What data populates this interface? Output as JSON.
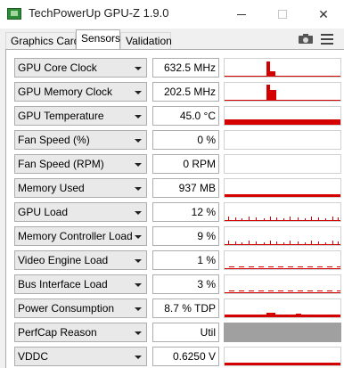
{
  "window": {
    "title": "TechPowerUp GPU-Z 1.9.0",
    "minimize_glyph": "—",
    "maximize_glyph": "☐",
    "close_glyph": "✕"
  },
  "tabs": [
    {
      "label": "Graphics Card",
      "active": false
    },
    {
      "label": "Sensors",
      "active": true
    },
    {
      "label": "Validation",
      "active": false
    }
  ],
  "toolbar": {
    "camera_icon": "camera-icon",
    "menu_icon": "hamburger-menu-icon"
  },
  "graph_color": "#d40000",
  "sensors": [
    {
      "label": "GPU Core Clock",
      "value": "632.5 MHz",
      "graph": "spike-tall"
    },
    {
      "label": "GPU Memory Clock",
      "value": "202.5 MHz",
      "graph": "spike-block"
    },
    {
      "label": "GPU Temperature",
      "value": "45.0 °C",
      "graph": "high-flat"
    },
    {
      "label": "Fan Speed (%)",
      "value": "0 %",
      "graph": "none"
    },
    {
      "label": "Fan Speed (RPM)",
      "value": "0 RPM",
      "graph": "none"
    },
    {
      "label": "Memory Used",
      "value": "937 MB",
      "graph": "low-flat"
    },
    {
      "label": "GPU Load",
      "value": "12 %",
      "graph": "ticks"
    },
    {
      "label": "Memory Controller Load",
      "value": "9 %",
      "graph": "ticks"
    },
    {
      "label": "Video Engine Load",
      "value": "1 %",
      "graph": "dashes"
    },
    {
      "label": "Bus Interface Load",
      "value": "3 %",
      "graph": "dashes"
    },
    {
      "label": "Power Consumption",
      "value": "8.7 % TDP",
      "graph": "low-bumps"
    },
    {
      "label": "PerfCap Reason",
      "value": "Util",
      "graph": "disabled"
    },
    {
      "label": "VDDC",
      "value": "0.6250 V",
      "graph": "low-flat"
    }
  ]
}
